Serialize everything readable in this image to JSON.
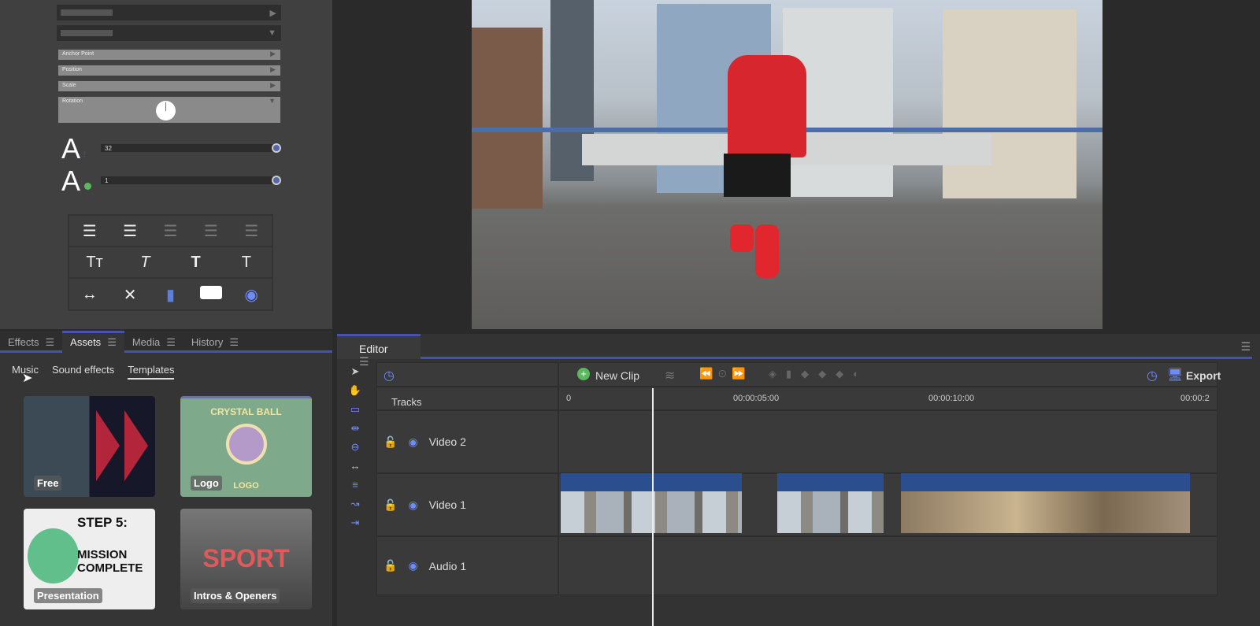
{
  "properties": {
    "rows": [
      "Anchor Point",
      "Position",
      "Scale",
      "Rotation"
    ],
    "font_size": "32",
    "stroke": "1",
    "glyph": "A"
  },
  "format": {
    "style_labels": [
      "Tт",
      "T",
      "T",
      "T"
    ]
  },
  "assets": {
    "tabs": [
      {
        "label": "Effects"
      },
      {
        "label": "Assets"
      },
      {
        "label": "Media"
      },
      {
        "label": "History"
      }
    ],
    "subtabs": [
      "Music",
      "Sound effects",
      "Templates"
    ],
    "cards": [
      "Free",
      "Logo",
      "Presentation",
      "Intros & Openers"
    ],
    "card_art": {
      "logo_title": "CRYSTAL BALL",
      "logo_sub": "LOGO",
      "step": "STEP 5:",
      "mission": "MISSION COMPLETE",
      "sport": "SPORT"
    }
  },
  "editor": {
    "tab": "Editor",
    "new_clip": "New Clip",
    "export": "Export",
    "tracks_label": "Tracks",
    "ruler": [
      "0",
      "00:00:05:00",
      "00:00:10:00",
      "00:00:2"
    ],
    "tracks": [
      "Video 2",
      "Video 1",
      "Audio 1"
    ],
    "accent": "#4452b0"
  }
}
